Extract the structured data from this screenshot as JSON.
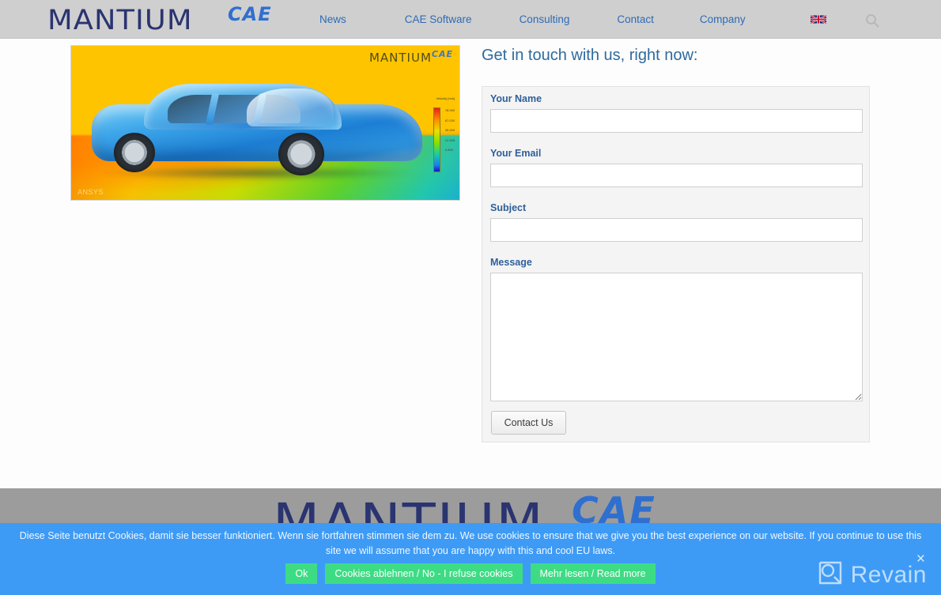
{
  "header": {
    "logo_main": "MANTIUM",
    "logo_sup": "CAE",
    "nav": [
      {
        "label": "News"
      },
      {
        "label": "CAE Software"
      },
      {
        "label": "Consulting"
      },
      {
        "label": "Contact"
      },
      {
        "label": "Company"
      }
    ],
    "language_icon": "uk-flag-icon",
    "search_icon": "search-icon"
  },
  "figure": {
    "overlay_logo_main": "MANTIUM",
    "overlay_logo_sup": "CAE",
    "legend_title": "Velocity [m/s]",
    "legend_ticks": [
      "78.930",
      "67.030",
      "35.009",
      "12.528",
      "4.303"
    ],
    "watermark": "ANSYS"
  },
  "contact": {
    "heading": "Get in touch with us, right now:",
    "fields": [
      {
        "label": "Your Name",
        "value": "",
        "placeholder": ""
      },
      {
        "label": "Your Email",
        "value": "",
        "placeholder": ""
      },
      {
        "label": "Subject",
        "value": "",
        "placeholder": ""
      }
    ],
    "message": {
      "label": "Message",
      "value": "",
      "placeholder": ""
    },
    "submit_label": "Contact Us"
  },
  "footer": {
    "logo_main": "MANTIUM",
    "logo_sup": "CAE"
  },
  "cookie": {
    "text": "Diese Seite benutzt Cookies, damit sie besser funktioniert. Wenn sie fortfahren stimmen sie dem zu. We use cookies to ensure that we give you the best experience on our website. If you continue to use this site we will assume that you are happy with this and cool EU laws.",
    "buttons": [
      {
        "label": "Ok"
      },
      {
        "label": "Cookies ablehnen / No - I refuse cookies"
      },
      {
        "label": "Mehr lesen / Read more"
      }
    ],
    "watermark_label": "Revain",
    "close_glyph": "×"
  },
  "colors": {
    "header_bg": "#cfcfcf",
    "nav_link": "#2e6bb3",
    "logo_navy": "#2a3470",
    "logo_blue": "#2f6fd0",
    "heading": "#2e6a9e",
    "panel_bg": "#f4f4f4",
    "label_blue": "#2e5f9a",
    "footer_bg": "#9c9c9c",
    "cookie_bg": "#3e9bf5",
    "cookie_btn": "#3ddc84"
  }
}
